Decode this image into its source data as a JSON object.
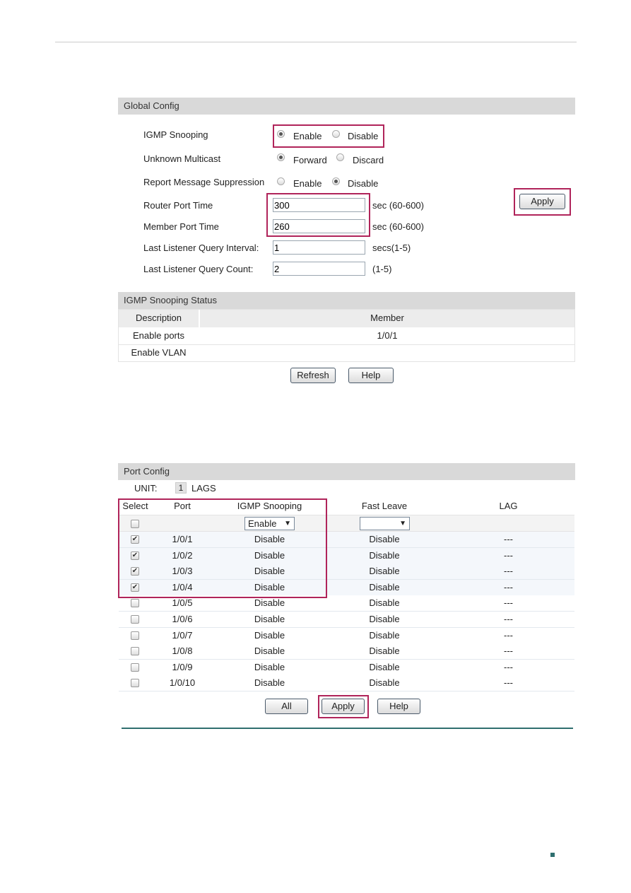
{
  "global_config": {
    "title": "Global Config",
    "igmp_snooping": {
      "label": "IGMP Snooping",
      "options": [
        "Enable",
        "Disable"
      ],
      "selected": "Enable"
    },
    "unknown_multicast": {
      "label": "Unknown Multicast",
      "options": [
        "Forward",
        "Discard"
      ],
      "selected": "Forward"
    },
    "report_suppression": {
      "label": "Report Message Suppression",
      "options": [
        "Enable",
        "Disable"
      ],
      "selected": "Disable"
    },
    "router_port_time": {
      "label": "Router Port Time",
      "value": "300",
      "unit": "sec (60-600)"
    },
    "member_port_time": {
      "label": "Member Port Time",
      "value": "260",
      "unit": "sec (60-600)"
    },
    "llq_interval": {
      "label": "Last Listener Query Interval:",
      "value": "1",
      "unit": "secs(1-5)"
    },
    "llq_count": {
      "label": "Last Listener Query Count:",
      "value": "2",
      "unit": "(1-5)"
    },
    "apply_label": "Apply"
  },
  "status": {
    "title": "IGMP Snooping Status",
    "headers": [
      "Description",
      "Member"
    ],
    "rows": [
      [
        "Enable ports",
        "1/0/1"
      ],
      [
        "Enable VLAN",
        ""
      ]
    ],
    "refresh_label": "Refresh",
    "help_label": "Help"
  },
  "port_config": {
    "title": "Port Config",
    "unit_label": "UNIT:",
    "unit_value": "1",
    "lags_label": "LAGS",
    "headers": [
      "Select",
      "Port",
      "IGMP Snooping",
      "Fast Leave",
      "LAG"
    ],
    "filter_igmp": "Enable",
    "filter_fast_leave": "",
    "rows": [
      {
        "checked": true,
        "port": "1/0/1",
        "igmp": "Disable",
        "fast_leave": "Disable",
        "lag": "---"
      },
      {
        "checked": true,
        "port": "1/0/2",
        "igmp": "Disable",
        "fast_leave": "Disable",
        "lag": "---"
      },
      {
        "checked": true,
        "port": "1/0/3",
        "igmp": "Disable",
        "fast_leave": "Disable",
        "lag": "---"
      },
      {
        "checked": true,
        "port": "1/0/4",
        "igmp": "Disable",
        "fast_leave": "Disable",
        "lag": "---"
      },
      {
        "checked": false,
        "port": "1/0/5",
        "igmp": "Disable",
        "fast_leave": "Disable",
        "lag": "---"
      },
      {
        "checked": false,
        "port": "1/0/6",
        "igmp": "Disable",
        "fast_leave": "Disable",
        "lag": "---"
      },
      {
        "checked": false,
        "port": "1/0/7",
        "igmp": "Disable",
        "fast_leave": "Disable",
        "lag": "---"
      },
      {
        "checked": false,
        "port": "1/0/8",
        "igmp": "Disable",
        "fast_leave": "Disable",
        "lag": "---"
      },
      {
        "checked": false,
        "port": "1/0/9",
        "igmp": "Disable",
        "fast_leave": "Disable",
        "lag": "---"
      },
      {
        "checked": false,
        "port": "1/0/10",
        "igmp": "Disable",
        "fast_leave": "Disable",
        "lag": "---"
      }
    ],
    "all_label": "All",
    "apply_label": "Apply",
    "help_label": "Help"
  },
  "colors": {
    "highlight": "#b0245a",
    "divider": "#2f6f6f",
    "header_bg": "#d9d9d9"
  }
}
